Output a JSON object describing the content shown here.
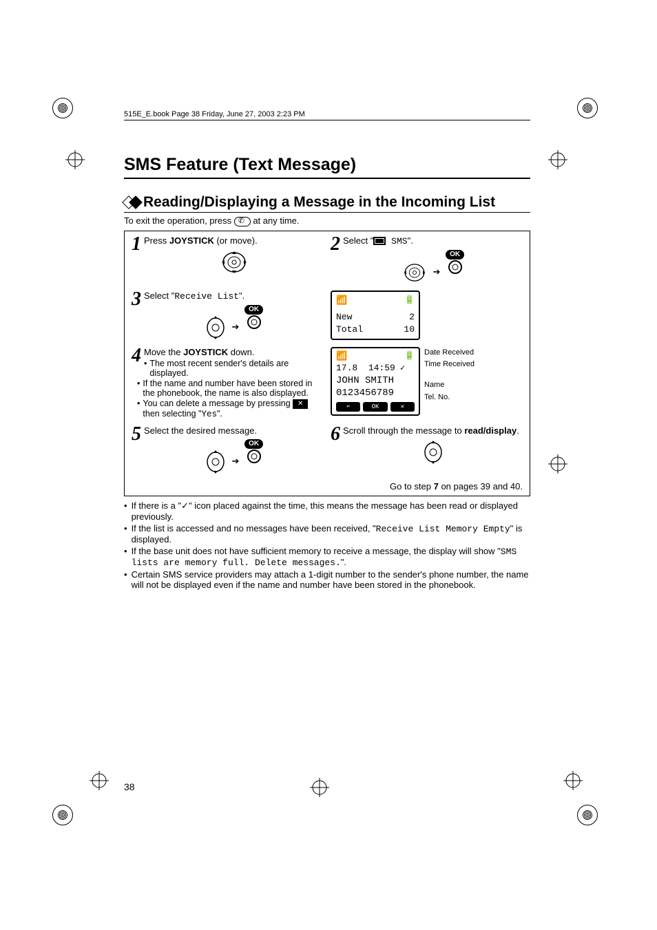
{
  "book_header": "515E_E.book  Page 38  Friday, June 27, 2003  2:23 PM",
  "page_number": "38",
  "title": "SMS Feature (Text Message)",
  "section_title": "Reading/Displaying a Message in the Incoming List",
  "exit_line_pre": "To exit the operation, press ",
  "exit_line_post": " at any time.",
  "step1": {
    "num": "1",
    "text_pre": "Press ",
    "text_bold": "JOYSTICK",
    "text_post": " (or move)."
  },
  "step2": {
    "num": "2",
    "text_pre": "Select \"",
    "text_mono": " SMS",
    "text_post": "\".",
    "ok": "OK"
  },
  "step3": {
    "num": "3",
    "text_pre": "Select \"",
    "text_mono": "Receive List",
    "text_post": "\".",
    "ok": "OK"
  },
  "screen1": {
    "new_label": "New",
    "new_val": "2",
    "total_label": "Total",
    "total_val": "10"
  },
  "step4": {
    "num": "4",
    "text_pre": "Move the ",
    "text_bold": "JOYSTICK",
    "text_post": " down.",
    "bullets": [
      "The most recent sender's details are displayed.",
      "If the name and number have been stored in the phonebook, the name is also displayed."
    ],
    "bullet3_pre": "You can delete a message by pressing ",
    "bullet3_mid": " then selecting \"",
    "bullet3_mono": "Yes",
    "bullet3_post": "\"."
  },
  "screen2": {
    "date": "17.8",
    "time": "14:59",
    "name": "JOHN SMITH",
    "tel": "0123456789",
    "annot_date": "Date Received",
    "annot_time": "Time Received",
    "annot_name": "Name",
    "annot_tel": "Tel. No.",
    "soft_back": "↶",
    "soft_ok": "OK",
    "soft_x": "✕"
  },
  "step5": {
    "num": "5",
    "text": "Select the desired message.",
    "ok": "OK"
  },
  "step6": {
    "num": "6",
    "text_pre": "Scroll through the message to ",
    "text_bold": "read/display",
    "text_post": "."
  },
  "goto_pre": "Go to step ",
  "goto_bold": "7",
  "goto_post": " on pages 39 and 40.",
  "notes": {
    "n1_pre": "If there is a \"",
    "n1_icon": "✓",
    "n1_post": "\" icon placed against the time, this means the message has been read or displayed previously.",
    "n2_pre": "If the list is accessed and no messages have been received, \"",
    "n2_mono": "Receive List Memory Empty",
    "n2_post": "\" is displayed.",
    "n3_pre": "If the base unit does not have sufficient memory to receive a message, the display will show \"",
    "n3_mono": "SMS lists are memory full. Delete messages.",
    "n3_post": "\".",
    "n4": "Certain SMS service providers may attach a 1-digit number to the sender's phone number, the name will not be displayed even if the name and number have been stored in the phonebook."
  }
}
